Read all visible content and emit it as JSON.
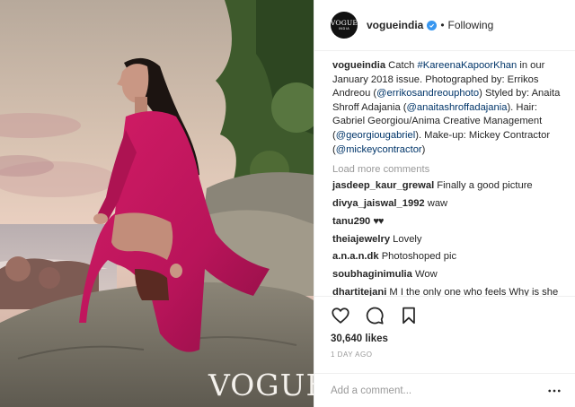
{
  "photo": {
    "brand": "VOGUE",
    "alt": "Woman in magenta trench coat crouching on a rock by the sea"
  },
  "header": {
    "avatar_line1": "VOGUE",
    "avatar_line2": "INDIA",
    "username": "vogueindia",
    "separator": "•",
    "follow_status": "Following"
  },
  "caption": {
    "username": "vogueindia",
    "t1": " Catch ",
    "tag1": "#KareenaKapoorKhan",
    "t2": " in our January 2018 issue. Photographed by: Errikos Andreou (",
    "mention1": "@errikosandreouphoto",
    "t3": ") Styled by: Anaita Shroff Adajania (",
    "mention2": "@anaitashroffadajania",
    "t4": "). Hair: Gabriel Georgiou/Anima Creative Management (",
    "mention3": "@georgiougabriel",
    "t5": "). Make-up: Mickey Contractor (",
    "mention4": "@mickeycontractor",
    "t6": ")"
  },
  "load_more": "Load more comments",
  "comments": [
    {
      "user": "jasdeep_kaur_grewal",
      "text": "Finally a good picture"
    },
    {
      "user": "divya_jaiswal_1992",
      "text": "waw"
    },
    {
      "user": "tanu290",
      "text": ""
    },
    {
      "user": "theiajewelry",
      "text": "Lovely"
    },
    {
      "user": "a.n.a.n.dk",
      "text": "Photoshoped pic"
    },
    {
      "user": "soubhaginimulia",
      "text": "Wow"
    },
    {
      "user": "dhartitejani",
      "text": "M I the only one who feels Why is she sitting in a toilet pose???"
    }
  ],
  "tanu_hearts": "♥♥",
  "likes": "30,640 likes",
  "time_ago": "1 DAY AGO",
  "add_comment_placeholder": "Add a comment...",
  "icons": {
    "like": "heart-outline-icon",
    "comment": "speech-bubble-icon",
    "save": "bookmark-icon",
    "verified": "verified-badge-icon",
    "more": "ellipsis-icon"
  },
  "colors": {
    "link": "#003569",
    "verified": "#3897f0",
    "muted": "#999999",
    "coat": "#c0175c"
  }
}
